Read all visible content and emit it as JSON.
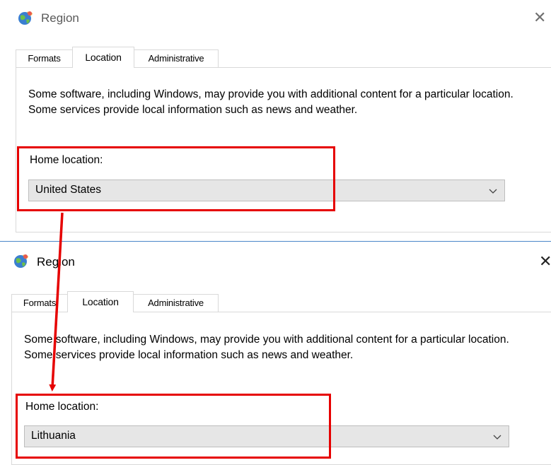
{
  "top_dialog": {
    "title": "Region",
    "close_glyph": "✕",
    "tabs": [
      "Formats",
      "Location",
      "Administrative"
    ],
    "active_tab": "Location",
    "description": "Some software, including Windows, may provide you with additional content for a particular location. Some services provide local information such as news and weather.",
    "home_location_label": "Home location:",
    "home_location_value": "United States"
  },
  "bottom_dialog": {
    "title": "Region",
    "close_glyph": "✕",
    "tabs": [
      "Formats",
      "Location",
      "Administrative"
    ],
    "active_tab": "Location",
    "description": "Some software, including Windows, may provide you with additional content for a particular location. Some services provide local information such as news and weather.",
    "home_location_label": "Home location:",
    "home_location_value": "Lithuania"
  },
  "icons": {
    "title_icon": "globe-icon",
    "dropdown_icon": "chevron-down-icon",
    "close_icon": "close-icon"
  },
  "colors": {
    "highlight": "#e60000",
    "divider": "#4a86c8",
    "combo_bg": "#e6e6e6"
  }
}
